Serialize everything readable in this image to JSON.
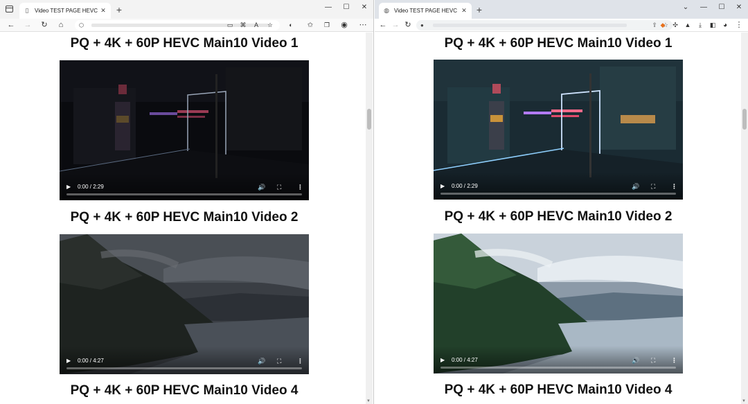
{
  "left_window": {
    "tab": {
      "title": "Video TEST PAGE HEVC",
      "close": "✕"
    },
    "new_tab": "+",
    "window_controls": {
      "minimize": "—",
      "maximize": "☐",
      "close": "✕"
    },
    "toolbar": {
      "back": "←",
      "forward": "→",
      "refresh": "↻",
      "home": "⌂",
      "lock": "🔒",
      "more": "⋯"
    },
    "videos": [
      {
        "heading": "PQ + 4K + 60P HEVC Main10 Video 1",
        "time": "0:00 / 2:29",
        "progress": 0
      },
      {
        "heading": "PQ + 4K + 60P HEVC Main10 Video 2",
        "time": "0:00 / 4:27",
        "progress": 0
      },
      {
        "heading": "PQ + 4K + 60P HEVC Main10 Video 4"
      }
    ]
  },
  "right_window": {
    "tab": {
      "title": "Video TEST PAGE HEVC",
      "close": "✕"
    },
    "new_tab": "+",
    "window_controls": {
      "dropdown": "⌄",
      "minimize": "—",
      "maximize": "☐",
      "close": "✕"
    },
    "toolbar": {
      "back": "←",
      "forward": "→",
      "refresh": "↻",
      "lock": "🔒",
      "more": "⋮"
    },
    "videos": [
      {
        "heading": "PQ + 4K + 60P HEVC Main10 Video 1",
        "time": "0:00 / 2:29",
        "progress": 0
      },
      {
        "heading": "PQ + 4K + 60P HEVC Main10 Video 2",
        "time": "0:00 / 4:27",
        "progress": 0
      },
      {
        "heading": "PQ + 4K + 60P HEVC Main10 Video 4"
      }
    ]
  },
  "controls": {
    "play": "▶",
    "volume": "🔊",
    "fullscreen": "⛶",
    "more": "⋮"
  },
  "colors": {
    "left_tabstrip": "#f3f3f3",
    "right_tabstrip": "#dfe3e9",
    "video_bg": "#000000"
  }
}
